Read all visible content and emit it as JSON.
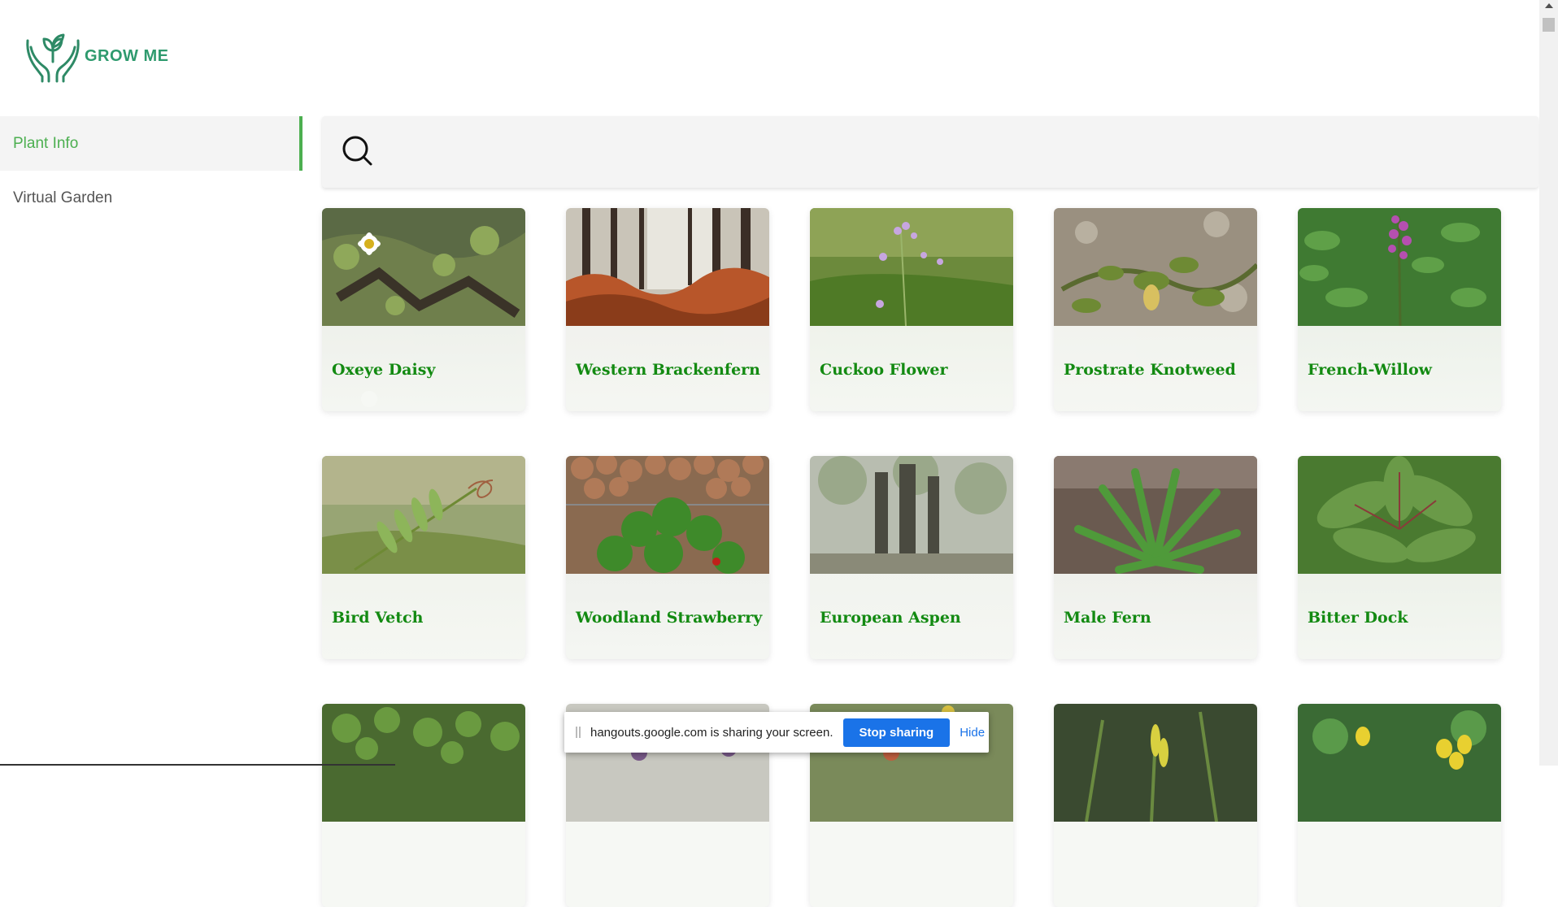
{
  "brand": {
    "name": "GROW ME",
    "color": "#2e9a6e"
  },
  "sidebar": {
    "items": [
      {
        "label": "Plant Info",
        "active": true
      },
      {
        "label": "Virtual Garden",
        "active": false
      }
    ],
    "accent": "#4caf50"
  },
  "search": {
    "placeholder": "",
    "value": ""
  },
  "plants": [
    {
      "name": "Oxeye Daisy",
      "icon": "daisy"
    },
    {
      "name": "Western Brackenfern",
      "icon": "forest-fern"
    },
    {
      "name": "Cuckoo Flower",
      "icon": "cuckoo-flower"
    },
    {
      "name": "Prostrate Knotweed",
      "icon": "knotweed"
    },
    {
      "name": "French-Willow",
      "icon": "fireweed"
    },
    {
      "name": "Bird Vetch",
      "icon": "vetch"
    },
    {
      "name": "Woodland Strawberry",
      "icon": "strawberry"
    },
    {
      "name": "European Aspen",
      "icon": "aspen"
    },
    {
      "name": "Male Fern",
      "icon": "fern"
    },
    {
      "name": "Bitter Dock",
      "icon": "dock"
    },
    {
      "name": "",
      "icon": "leafy-ground"
    },
    {
      "name": "",
      "icon": "purple-flowers"
    },
    {
      "name": "",
      "icon": "red-flowers"
    },
    {
      "name": "",
      "icon": "yellow-iris"
    },
    {
      "name": "",
      "icon": "yellow-flowers"
    }
  ],
  "share_bar": {
    "message": "hangouts.google.com is sharing your screen.",
    "stop_label": "Stop sharing",
    "hide_label": "Hide"
  }
}
